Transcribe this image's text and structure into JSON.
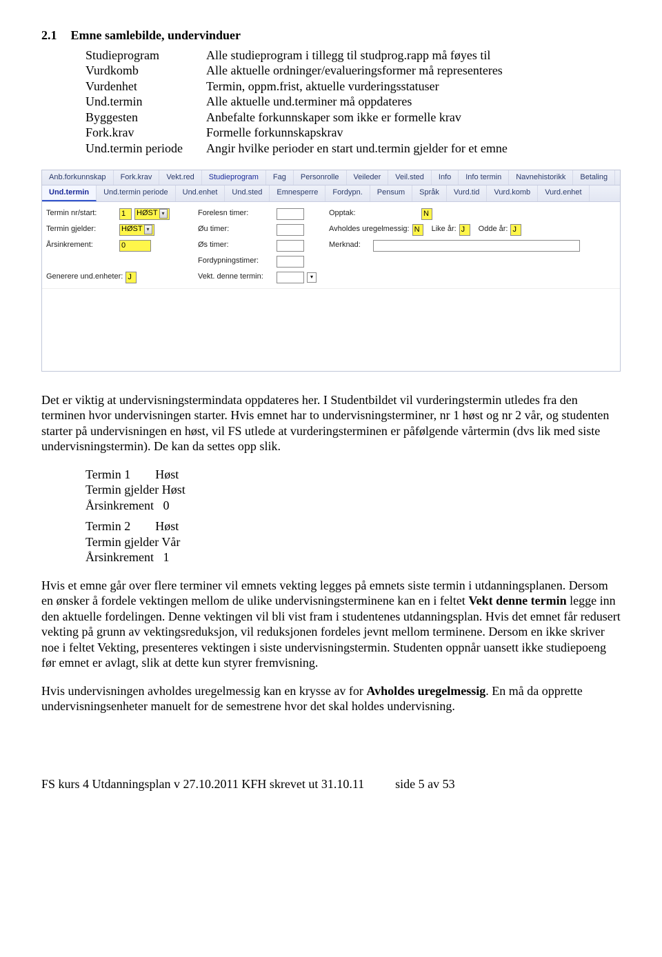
{
  "heading": {
    "number": "2.1",
    "title": "Emne samlebilde, undervinduer"
  },
  "defs": [
    {
      "term": "Studieprogram",
      "desc": "Alle studieprogram i tillegg til studprog.rapp må føyes til"
    },
    {
      "term": "Vurdkomb",
      "desc": "Alle aktuelle ordninger/evalueringsformer må representeres"
    },
    {
      "term": "Vurdenhet",
      "desc": "Termin, oppm.frist, aktuelle vurderingsstatuser"
    },
    {
      "term": "Und.termin",
      "desc": "Alle aktuelle und.terminer må oppdateres"
    },
    {
      "term": "Byggesten",
      "desc": "Anbefalte forkunnskaper som ikke er formelle krav"
    },
    {
      "term": "Fork.krav",
      "desc": "Formelle forkunnskapskrav"
    },
    {
      "term": "Und.termin periode",
      "desc": "Angir hvilke perioder en start und.termin gjelder for et emne"
    }
  ],
  "tabs_row1": [
    "Anb.forkunnskap",
    "Fork.krav",
    "Vekt.red",
    "Studieprogram",
    "Fag",
    "Personrolle",
    "Veileder",
    "Veil.sted",
    "Info",
    "Info termin",
    "Navnehistorikk",
    "Betaling"
  ],
  "tabs_row2": [
    "Und.termin",
    "Und.termin periode",
    "Und.enhet",
    "Und.sted",
    "Emnesperre",
    "Fordypn.",
    "Pensum",
    "Språk",
    "Vurd.tid",
    "Vurd.komb",
    "Vurd.enhet"
  ],
  "tabs_hl_row1": "Studieprogram",
  "tabs_active_row2": "Und.termin",
  "form": {
    "col1": {
      "termin_nr_start_label": "Termin nr/start:",
      "termin_nr_value": "1",
      "termin_sel_value": "HØST",
      "termin_gjelder_label": "Termin gjelder:",
      "termin_gjelder_value": "HØST",
      "arsinkrement_label": "Årsinkrement:",
      "arsinkrement_value": "0",
      "generere_label": "Generere und.enheter:",
      "generere_value": "J"
    },
    "col2": {
      "forelesn_label": "Forelesn timer:",
      "ou_label": "Øu timer:",
      "os_label": "Øs timer:",
      "fordyp_label": "Fordypningstimer:",
      "vekt_label": "Vekt. denne termin:"
    },
    "col3": {
      "opptak_label": "Opptak:",
      "opptak_value": "N",
      "avholdes_label": "Avholdes uregelmessig:",
      "avholdes_value": "N",
      "like_label": "Like år:",
      "like_value": "J",
      "odde_label": "Odde år:",
      "odde_value": "J",
      "merknad_label": "Merknad:"
    }
  },
  "para1_a": "Det er viktig at undervisningstermindata oppdateres her. I Studentbildet vil vurderingstermin utledes fra den terminen hvor undervisningen starter. Hvis emnet har to undervisningsterminer, nr 1 høst og nr 2 vår, og studenten starter på undervisningen en høst, vil FS utlede at vurderingsterminen er påfølgende vårtermin (dvs lik med siste undervisningstermin). De kan da settes opp slik.",
  "block_a": [
    "Termin 1        Høst",
    "Termin gjelder Høst",
    "Årsinkrement   0"
  ],
  "block_b": [
    "Termin 2        Høst",
    "Termin gjelder Vår",
    "Årsinkrement   1"
  ],
  "para2_pre": "Hvis et emne går over flere terminer vil emnets vekting legges på emnets siste termin i utdanningsplanen. Dersom en ønsker å fordele vektingen mellom de ulike undervisningsterminene kan en i feltet ",
  "para2_bold": "Vekt denne termin ",
  "para2_post": "legge inn den aktuelle fordelingen. Denne vektingen vil bli vist fram i studentenes utdanningsplan. Hvis det emnet får redusert vekting på grunn av vektingsreduksjon, vil reduksjonen fordeles jevnt mellom terminene. Dersom en ikke skriver noe i feltet Vekting, presenteres vektingen i siste undervisningstermin. Studenten oppnår uansett ikke studiepoeng før emnet er avlagt, slik at dette kun styrer fremvisning.",
  "para3_pre": "Hvis undervisningen avholdes uregelmessig kan en krysse av for ",
  "para3_bold": "Avholdes uregelmessig",
  "para3_post": ". En må da opprette undervisningsenheter manuelt for de semestrene hvor det skal holdes undervisning.",
  "footer": "FS kurs 4 Utdanningsplan v 27.10.2011 KFH skrevet ut 31.10.11          side 5 av 53"
}
